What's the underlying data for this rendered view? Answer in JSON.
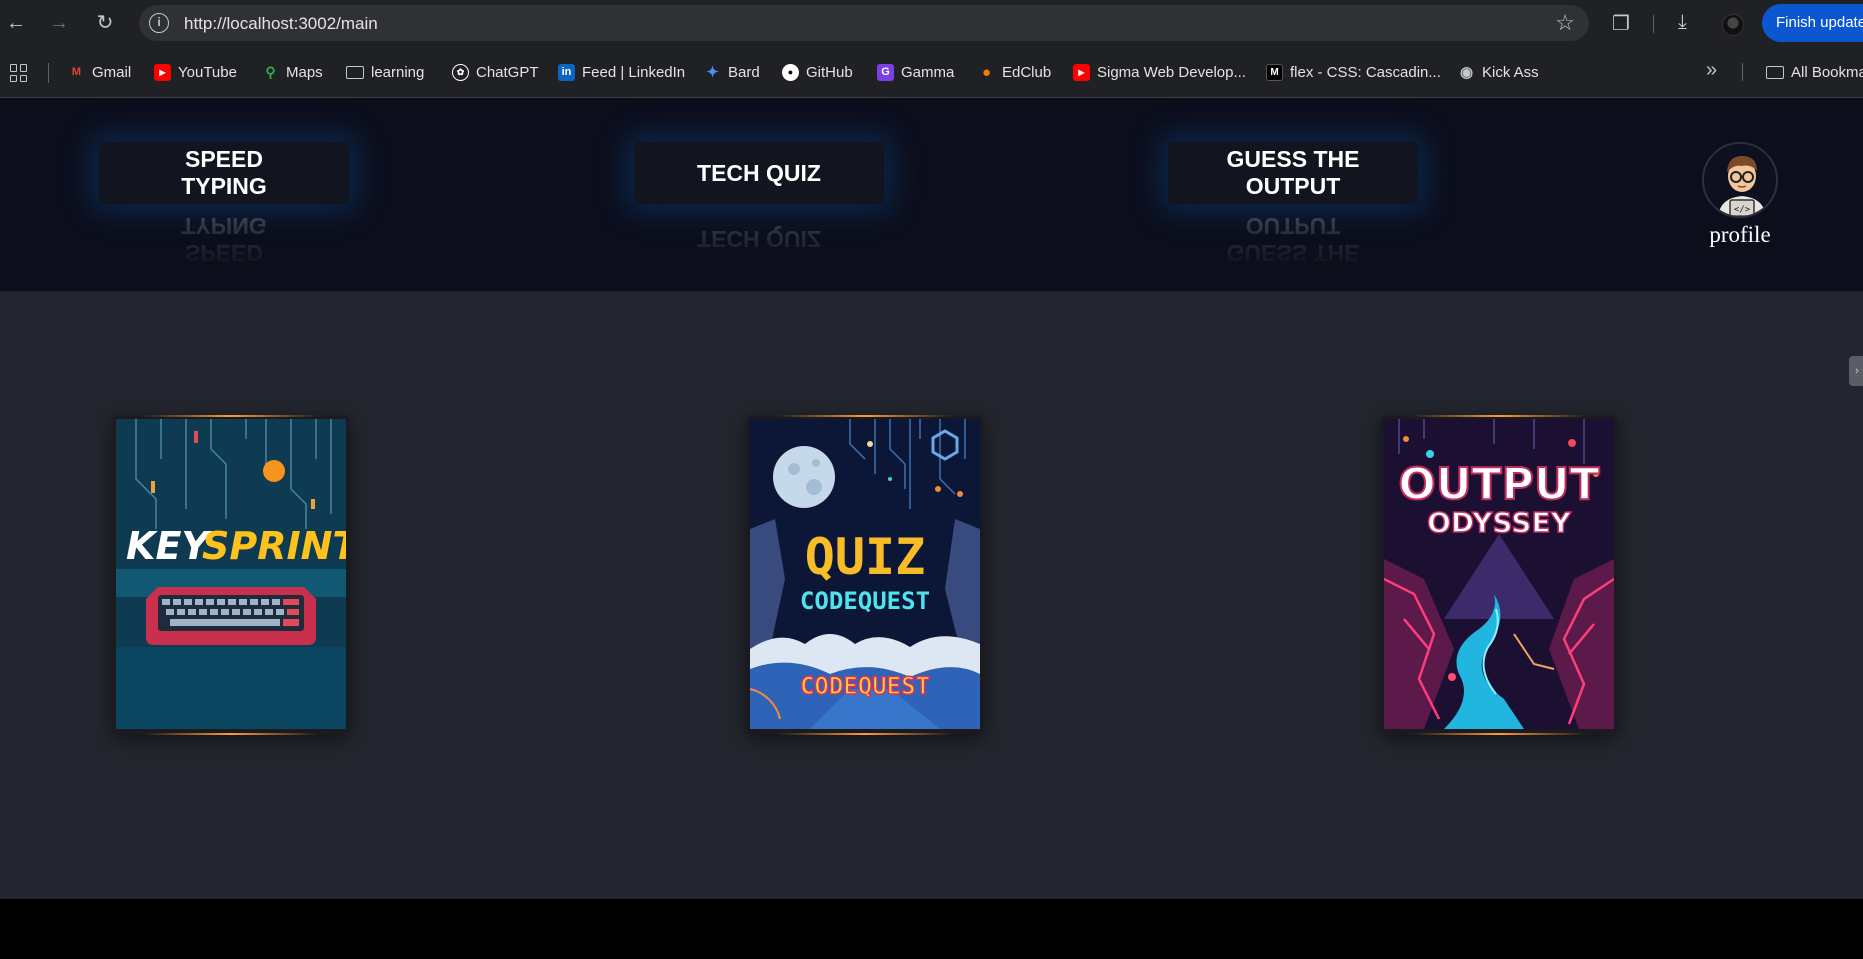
{
  "browser": {
    "url": "http://localhost:3002/main",
    "update_button": "Finish update",
    "bookmarks": [
      {
        "label": "Gmail",
        "icon": "gmail-icon",
        "color": "#ea4335"
      },
      {
        "label": "YouTube",
        "icon": "youtube-icon",
        "color": "#ff0000"
      },
      {
        "label": "Maps",
        "icon": "maps-icon",
        "color": "#34a853"
      },
      {
        "label": "learning",
        "icon": "folder-icon",
        "color": "#c4c7c5"
      },
      {
        "label": "ChatGPT",
        "icon": "chatgpt-icon",
        "color": "#ffffff"
      },
      {
        "label": "Feed | LinkedIn",
        "icon": "linkedin-icon",
        "color": "#0a66c2"
      },
      {
        "label": "Bard",
        "icon": "bard-icon",
        "color": "#4c8df6"
      },
      {
        "label": "GitHub",
        "icon": "github-icon",
        "color": "#ffffff"
      },
      {
        "label": "Gamma",
        "icon": "gamma-icon",
        "color": "#7b3fe4"
      },
      {
        "label": "EdClub",
        "icon": "edclub-icon",
        "color": "#f57c00"
      },
      {
        "label": "Sigma Web Develop...",
        "icon": "youtube-icon",
        "color": "#ff0000"
      },
      {
        "label": "flex - CSS: Cascadin...",
        "icon": "mdn-icon",
        "color": "#000000"
      },
      {
        "label": "Kick Ass",
        "icon": "globe-icon",
        "color": "#c4c7c5"
      }
    ],
    "all_bookmarks": "All Bookmarks"
  },
  "header": {
    "nav": [
      {
        "label": "SPEED\nTYPING"
      },
      {
        "label": "TECH QUIZ"
      },
      {
        "label": "GUESS THE\nOUTPUT"
      }
    ],
    "profile_label": "profile"
  },
  "cards": [
    {
      "title_a": "KEY",
      "title_b": "SPRINT"
    },
    {
      "title": "QUIZ",
      "subtitle": "CODEQUEST",
      "footer": "CODEQUEST"
    },
    {
      "title": "OUTPUT",
      "subtitle": "ODYSSEY"
    }
  ],
  "colors": {
    "accent_orange": "#ff9b3a",
    "header_bg": "#0c0e1c",
    "page_bg": "#23262e"
  }
}
